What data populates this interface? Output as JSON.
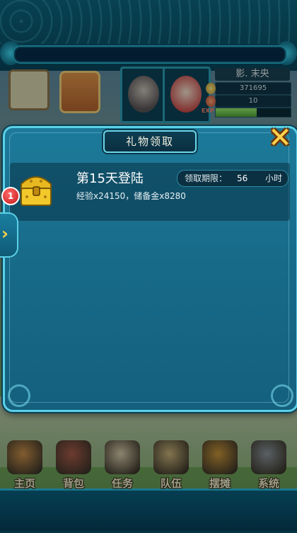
{
  "player": {
    "name": "影. 末央",
    "gold": "371695",
    "ingots": "10",
    "exp_label": "EXP",
    "exp_progress": 0.55
  },
  "dialog": {
    "title": "礼物领取",
    "close_icon": "close-x-icon"
  },
  "rewards": [
    {
      "title": "第15天登陆",
      "description": "经验x24150，储备金x8280",
      "expire_label": "领取期限：",
      "expire_value": "56",
      "expire_unit": "小时",
      "icon": "treasure-chest-icon"
    }
  ],
  "side_tab": {
    "badge_count": "1",
    "arrow_icon": "chevron-right-icon"
  },
  "bottom_nav": [
    {
      "label": "主页",
      "icon": "home-icon"
    },
    {
      "label": "背包",
      "icon": "bag-icon"
    },
    {
      "label": "任务",
      "icon": "scroll-icon"
    },
    {
      "label": "队伍",
      "icon": "team-icon"
    },
    {
      "label": "摆摊",
      "icon": "stall-icon"
    },
    {
      "label": "系统",
      "icon": "gear-icon"
    }
  ],
  "colors": {
    "accent": "#5ad0e6",
    "panel": "#176a88",
    "gold_text": "#ffd24a"
  }
}
